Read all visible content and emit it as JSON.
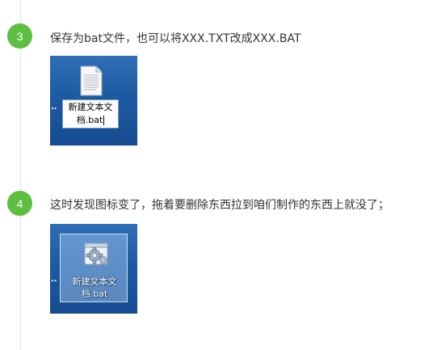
{
  "steps": [
    {
      "number": "3",
      "text": "保存为bat文件，也可以将XXX.TXT改成XXX.BAT",
      "badge_color": "#5cbf3f",
      "screenshot": {
        "icon": "text-document-icon",
        "dots": "..",
        "filename_line1": "新建文本文",
        "filename_line2": "档.bat",
        "state": "renaming"
      }
    },
    {
      "number": "4",
      "text": "这时发现图标变了，拖着要删除东西拉到咱们制作的东西上就没了；",
      "badge_color": "#5cbf3f",
      "screenshot": {
        "icon": "batch-file-gear-icon",
        "dots": "..",
        "filename_line1": "新建文本文",
        "filename_line2": "档.bat",
        "state": "selected"
      }
    }
  ],
  "colors": {
    "accent": "#5cbf3f",
    "desktop_blue": "#1d5aa3",
    "text": "#333333"
  }
}
